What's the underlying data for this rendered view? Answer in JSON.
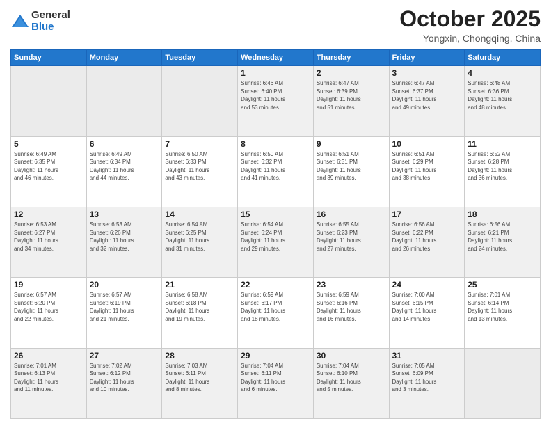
{
  "logo": {
    "general": "General",
    "blue": "Blue"
  },
  "header": {
    "month": "October 2025",
    "location": "Yongxin, Chongqing, China"
  },
  "weekdays": [
    "Sunday",
    "Monday",
    "Tuesday",
    "Wednesday",
    "Thursday",
    "Friday",
    "Saturday"
  ],
  "weeks": [
    [
      {
        "day": "",
        "info": ""
      },
      {
        "day": "",
        "info": ""
      },
      {
        "day": "",
        "info": ""
      },
      {
        "day": "1",
        "info": "Sunrise: 6:46 AM\nSunset: 6:40 PM\nDaylight: 11 hours\nand 53 minutes."
      },
      {
        "day": "2",
        "info": "Sunrise: 6:47 AM\nSunset: 6:39 PM\nDaylight: 11 hours\nand 51 minutes."
      },
      {
        "day": "3",
        "info": "Sunrise: 6:47 AM\nSunset: 6:37 PM\nDaylight: 11 hours\nand 49 minutes."
      },
      {
        "day": "4",
        "info": "Sunrise: 6:48 AM\nSunset: 6:36 PM\nDaylight: 11 hours\nand 48 minutes."
      }
    ],
    [
      {
        "day": "5",
        "info": "Sunrise: 6:49 AM\nSunset: 6:35 PM\nDaylight: 11 hours\nand 46 minutes."
      },
      {
        "day": "6",
        "info": "Sunrise: 6:49 AM\nSunset: 6:34 PM\nDaylight: 11 hours\nand 44 minutes."
      },
      {
        "day": "7",
        "info": "Sunrise: 6:50 AM\nSunset: 6:33 PM\nDaylight: 11 hours\nand 43 minutes."
      },
      {
        "day": "8",
        "info": "Sunrise: 6:50 AM\nSunset: 6:32 PM\nDaylight: 11 hours\nand 41 minutes."
      },
      {
        "day": "9",
        "info": "Sunrise: 6:51 AM\nSunset: 6:31 PM\nDaylight: 11 hours\nand 39 minutes."
      },
      {
        "day": "10",
        "info": "Sunrise: 6:51 AM\nSunset: 6:29 PM\nDaylight: 11 hours\nand 38 minutes."
      },
      {
        "day": "11",
        "info": "Sunrise: 6:52 AM\nSunset: 6:28 PM\nDaylight: 11 hours\nand 36 minutes."
      }
    ],
    [
      {
        "day": "12",
        "info": "Sunrise: 6:53 AM\nSunset: 6:27 PM\nDaylight: 11 hours\nand 34 minutes."
      },
      {
        "day": "13",
        "info": "Sunrise: 6:53 AM\nSunset: 6:26 PM\nDaylight: 11 hours\nand 32 minutes."
      },
      {
        "day": "14",
        "info": "Sunrise: 6:54 AM\nSunset: 6:25 PM\nDaylight: 11 hours\nand 31 minutes."
      },
      {
        "day": "15",
        "info": "Sunrise: 6:54 AM\nSunset: 6:24 PM\nDaylight: 11 hours\nand 29 minutes."
      },
      {
        "day": "16",
        "info": "Sunrise: 6:55 AM\nSunset: 6:23 PM\nDaylight: 11 hours\nand 27 minutes."
      },
      {
        "day": "17",
        "info": "Sunrise: 6:56 AM\nSunset: 6:22 PM\nDaylight: 11 hours\nand 26 minutes."
      },
      {
        "day": "18",
        "info": "Sunrise: 6:56 AM\nSunset: 6:21 PM\nDaylight: 11 hours\nand 24 minutes."
      }
    ],
    [
      {
        "day": "19",
        "info": "Sunrise: 6:57 AM\nSunset: 6:20 PM\nDaylight: 11 hours\nand 22 minutes."
      },
      {
        "day": "20",
        "info": "Sunrise: 6:57 AM\nSunset: 6:19 PM\nDaylight: 11 hours\nand 21 minutes."
      },
      {
        "day": "21",
        "info": "Sunrise: 6:58 AM\nSunset: 6:18 PM\nDaylight: 11 hours\nand 19 minutes."
      },
      {
        "day": "22",
        "info": "Sunrise: 6:59 AM\nSunset: 6:17 PM\nDaylight: 11 hours\nand 18 minutes."
      },
      {
        "day": "23",
        "info": "Sunrise: 6:59 AM\nSunset: 6:16 PM\nDaylight: 11 hours\nand 16 minutes."
      },
      {
        "day": "24",
        "info": "Sunrise: 7:00 AM\nSunset: 6:15 PM\nDaylight: 11 hours\nand 14 minutes."
      },
      {
        "day": "25",
        "info": "Sunrise: 7:01 AM\nSunset: 6:14 PM\nDaylight: 11 hours\nand 13 minutes."
      }
    ],
    [
      {
        "day": "26",
        "info": "Sunrise: 7:01 AM\nSunset: 6:13 PM\nDaylight: 11 hours\nand 11 minutes."
      },
      {
        "day": "27",
        "info": "Sunrise: 7:02 AM\nSunset: 6:12 PM\nDaylight: 11 hours\nand 10 minutes."
      },
      {
        "day": "28",
        "info": "Sunrise: 7:03 AM\nSunset: 6:11 PM\nDaylight: 11 hours\nand 8 minutes."
      },
      {
        "day": "29",
        "info": "Sunrise: 7:04 AM\nSunset: 6:11 PM\nDaylight: 11 hours\nand 6 minutes."
      },
      {
        "day": "30",
        "info": "Sunrise: 7:04 AM\nSunset: 6:10 PM\nDaylight: 11 hours\nand 5 minutes."
      },
      {
        "day": "31",
        "info": "Sunrise: 7:05 AM\nSunset: 6:09 PM\nDaylight: 11 hours\nand 3 minutes."
      },
      {
        "day": "",
        "info": ""
      }
    ]
  ]
}
